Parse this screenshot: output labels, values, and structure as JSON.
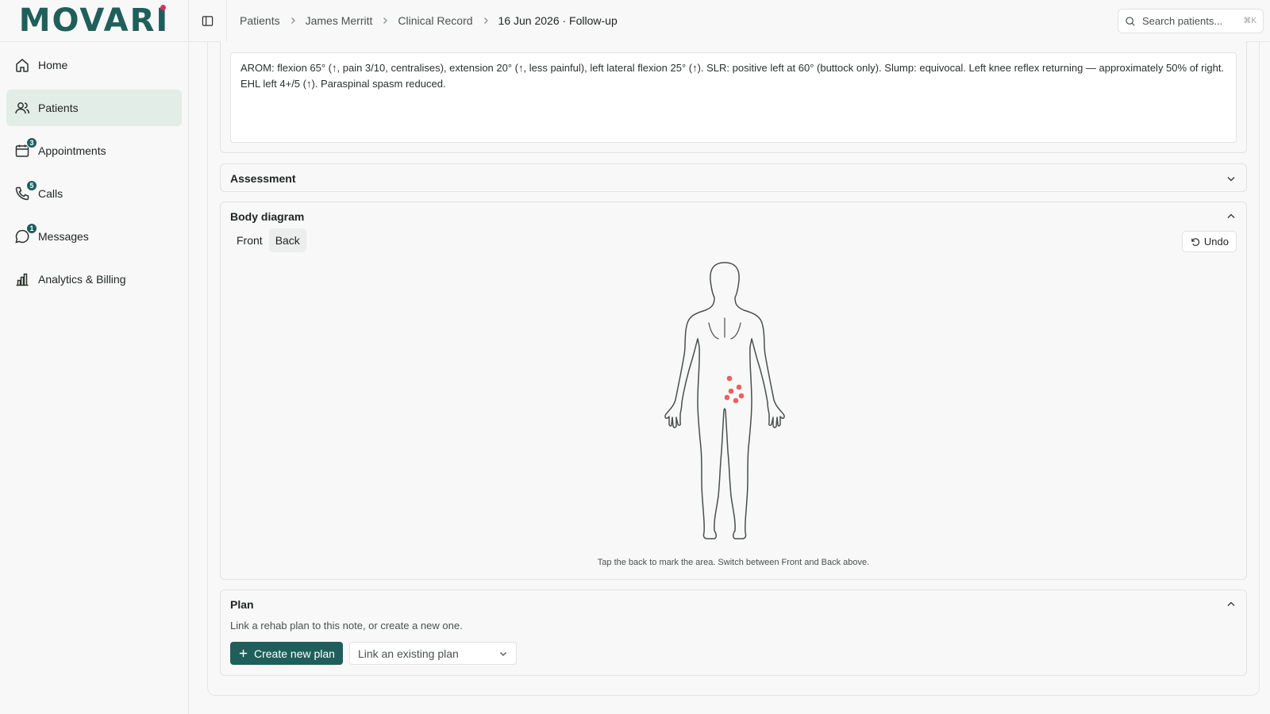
{
  "app": {
    "logo": "MOVARI",
    "logo_prefix": "MOVAR",
    "logo_suffix": "I"
  },
  "sidebar": {
    "items": [
      {
        "label": "Home",
        "icon": "home-icon",
        "active": false
      },
      {
        "label": "Patients",
        "icon": "users-icon",
        "active": true
      },
      {
        "label": "Appointments",
        "icon": "calendar-icon",
        "badge": "3"
      },
      {
        "label": "Calls",
        "icon": "phone-icon",
        "badge": "5"
      },
      {
        "label": "Messages",
        "icon": "message-icon",
        "badge": "1"
      },
      {
        "label": "Analytics & Billing",
        "icon": "bar-chart-icon"
      }
    ]
  },
  "breadcrumb": [
    "Patients",
    "James Merritt",
    "Clinical Record",
    "16 Jun 2026 · Follow-up"
  ],
  "search": {
    "placeholder": "Search patients...",
    "shortcut": "⌘K"
  },
  "objective_note": "AROM: flexion 65° (↑, pain 3/10, centralises), extension 20° (↑, less painful), left lateral flexion 25° (↑). SLR: positive left at 60° (buttock only). Slump: equivocal. Left knee reflex returning — approximately 50% of right. EHL left 4+/5 (↑). Paraspinal spasm reduced.",
  "assessment": {
    "title": "Assessment"
  },
  "body_diagram": {
    "title": "Body diagram",
    "tabs": [
      "Front",
      "Back"
    ],
    "selected_tab": "Back",
    "undo_label": "Undo",
    "hint": "Tap the back to mark the area. Switch between Front and Back above.",
    "marker_color": "#e8625f",
    "marker_count": 6
  },
  "plan": {
    "title": "Plan",
    "description": "Link a rehab plan to this note, or create a new one.",
    "create_label": "Create new plan",
    "select_placeholder": "Link an existing plan"
  },
  "colors": {
    "brand": "#1f5f5b",
    "active_nav": "#e2ede8",
    "accent_dot": "#d6345a"
  }
}
